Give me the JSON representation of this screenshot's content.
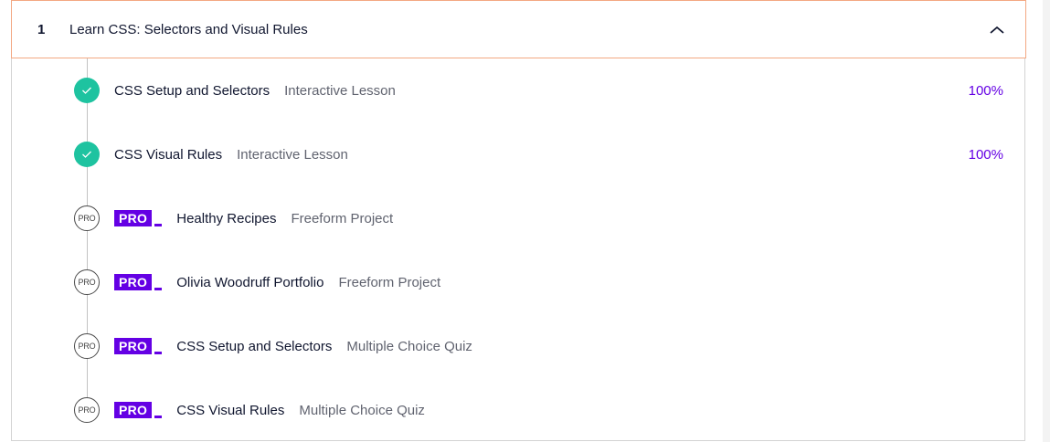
{
  "module": {
    "number": "1",
    "title": "Learn CSS: Selectors and Visual Rules",
    "collapse_icon": "chevron-up-icon"
  },
  "colors": {
    "accent": "#6400e4",
    "complete": "#1ec3a0",
    "header_border": "#f3a882"
  },
  "items": [
    {
      "status": "complete",
      "title": "CSS Setup and Selectors",
      "type": "Interactive Lesson",
      "progress": "100%"
    },
    {
      "status": "complete",
      "title": "CSS Visual Rules",
      "type": "Interactive Lesson",
      "progress": "100%"
    },
    {
      "status": "pro",
      "badge_text": "PRO",
      "pro_tag": "PRO",
      "title": "Healthy Recipes",
      "type": "Freeform Project"
    },
    {
      "status": "pro",
      "badge_text": "PRO",
      "pro_tag": "PRO",
      "title": "Olivia Woodruff Portfolio",
      "type": "Freeform Project"
    },
    {
      "status": "pro",
      "badge_text": "PRO",
      "pro_tag": "PRO",
      "title": "CSS Setup and Selectors",
      "type": "Multiple Choice Quiz"
    },
    {
      "status": "pro",
      "badge_text": "PRO",
      "pro_tag": "PRO",
      "title": "CSS Visual Rules",
      "type": "Multiple Choice Quiz"
    }
  ]
}
